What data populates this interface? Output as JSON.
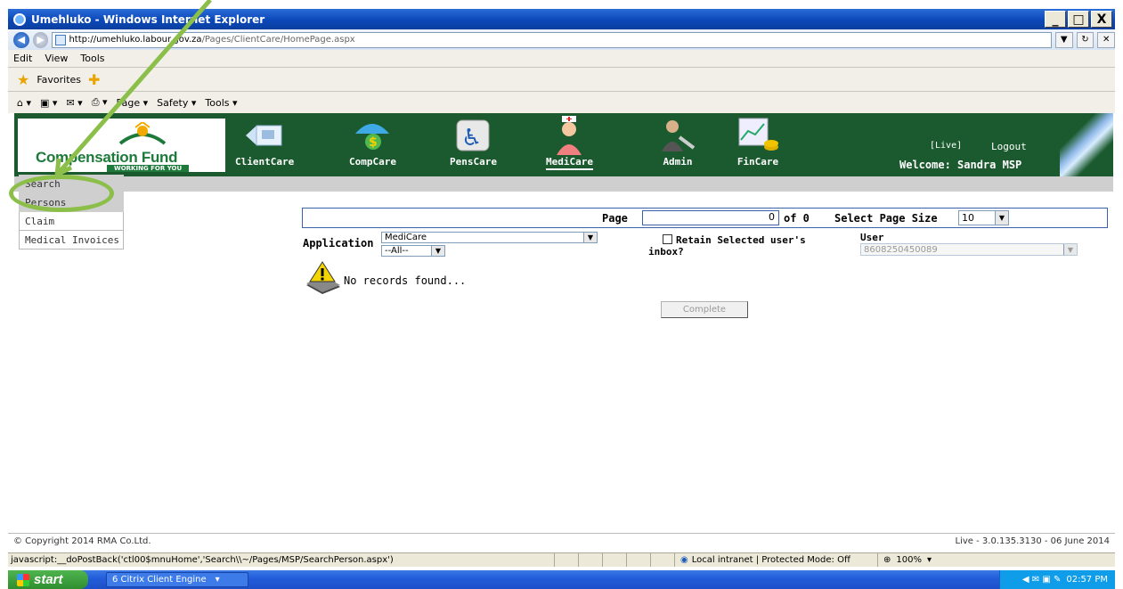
{
  "window": {
    "title": "Umehluko - Windows Internet Explorer",
    "minimize": "_",
    "maximize": "□",
    "close": "X"
  },
  "browser": {
    "address_host": "http://umehluko.labour.gov.za",
    "address_path": "/Pages/ClientCare/HomePage.aspx",
    "menu": [
      "Edit",
      "View",
      "Tools"
    ],
    "favorites_label": "Favorites",
    "commands": [
      "Page ▾",
      "Safety ▾",
      "Tools ▾"
    ]
  },
  "banner": {
    "logo_text": "Compensation Fund",
    "logo_sub": "WORKING FOR YOU",
    "modules": [
      {
        "label": "ClientCare",
        "icon": "client-card-icon"
      },
      {
        "label": "CompCare",
        "icon": "money-umbrella-icon"
      },
      {
        "label": "PensCare",
        "icon": "wheelchair-icon"
      },
      {
        "label": "MediCare",
        "icon": "nurse-icon"
      },
      {
        "label": "Admin",
        "icon": "admin-person-icon"
      },
      {
        "label": "FinCare",
        "icon": "finance-chart-icon"
      }
    ],
    "active_module": "MediCare",
    "live_tag": "[Live]",
    "logout": "Logout",
    "welcome": "Welcome: Sandra MSP"
  },
  "leftnav": {
    "items": [
      "Search",
      "Persons",
      "Claim",
      "Medical Invoices"
    ]
  },
  "pager": {
    "page_label": "Page",
    "page_value": "0",
    "of_label": "of 0",
    "size_label": "Select Page Size",
    "size_value": "10"
  },
  "form": {
    "application_label": "Application",
    "application_value": "MediCare",
    "filter_value": "--All--",
    "retain_label": "Retain Selected user's",
    "inbox_label": "inbox?",
    "user_label": "User",
    "user_value": "8608250450089"
  },
  "results": {
    "message": "No records found..."
  },
  "actions": {
    "complete": "Complete"
  },
  "footer": {
    "copyright": "© Copyright 2014 RMA Co.Ltd.",
    "version": "Live - 3.0.135.3130 - 06 June 2014"
  },
  "statusbar": {
    "text": "javascript:__doPostBack('ctl00$mnuHome','Search\\\\~/Pages/MSP/SearchPerson.aspx')",
    "zone": "Local intranet | Protected Mode: Off",
    "zoom": "100%"
  },
  "taskbar": {
    "start": "start",
    "task": "6 Citrix Client Engine",
    "clock": "02:57 PM"
  },
  "colors": {
    "banner_green": "#1a5a2e",
    "annotation_green": "#8bbf4a"
  }
}
